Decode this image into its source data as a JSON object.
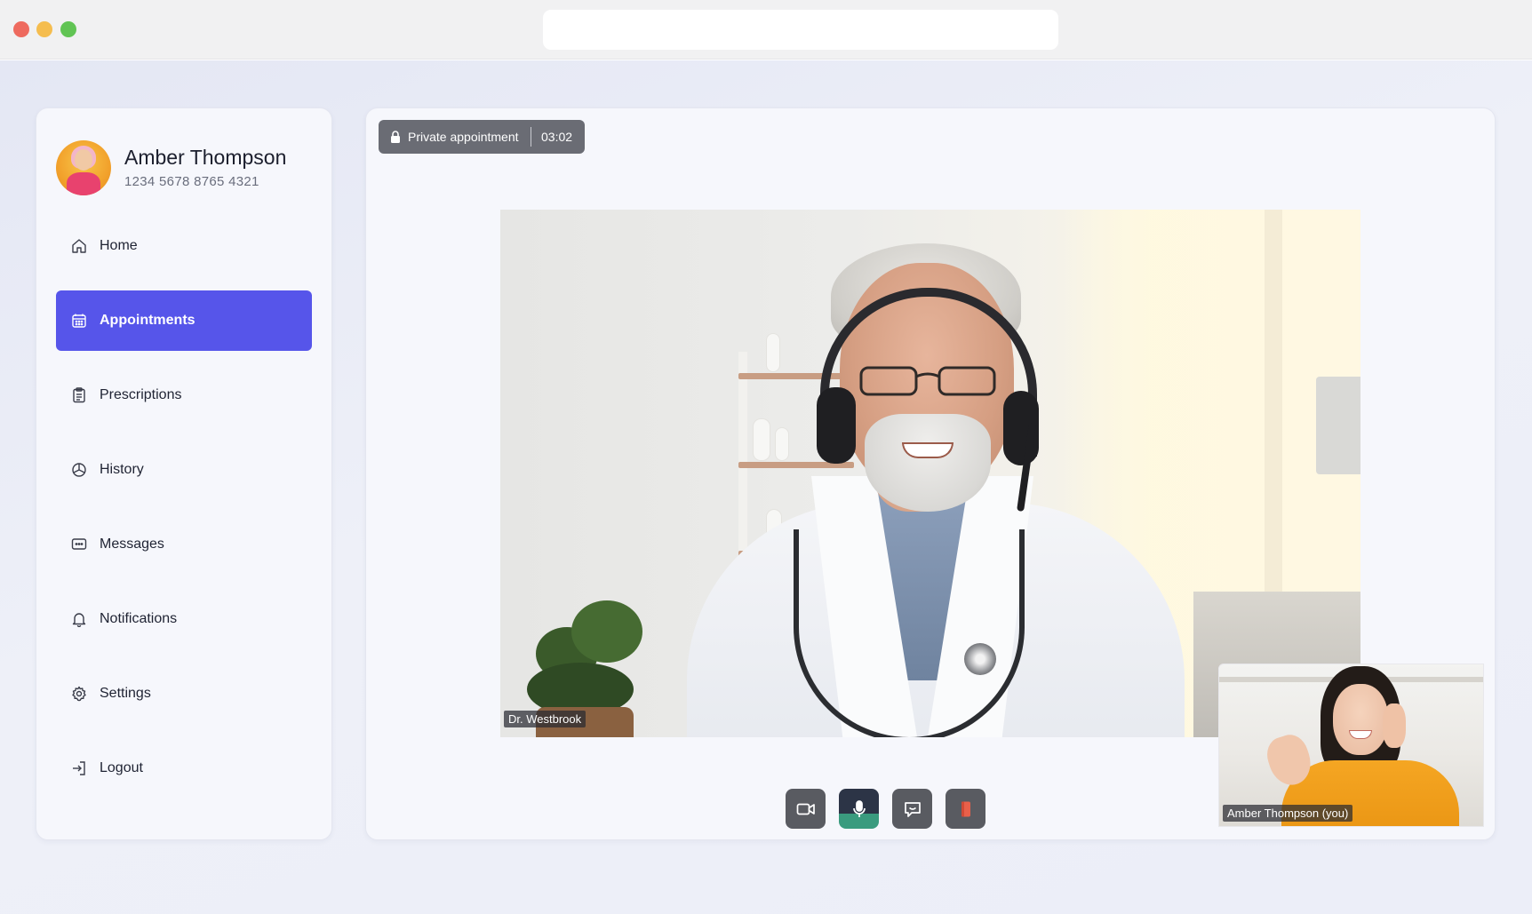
{
  "user": {
    "name": "Amber Thompson",
    "card_number": "1234 5678 8765 4321",
    "avatar_icon": "user-avatar"
  },
  "nav": {
    "items": [
      {
        "label": "Home",
        "icon": "home-icon",
        "active": false
      },
      {
        "label": "Appointments",
        "icon": "calendar-icon",
        "active": true
      },
      {
        "label": "Prescriptions",
        "icon": "clipboard-icon",
        "active": false
      },
      {
        "label": "History",
        "icon": "pie-chart-icon",
        "active": false
      },
      {
        "label": "Messages",
        "icon": "message-icon",
        "active": false
      },
      {
        "label": "Notifications",
        "icon": "bell-icon",
        "active": false
      },
      {
        "label": "Settings",
        "icon": "gear-icon",
        "active": false
      },
      {
        "label": "Logout",
        "icon": "logout-icon",
        "active": false
      }
    ]
  },
  "call": {
    "status_label": "Private appointment",
    "timer": "03:02",
    "remote_participant": "Dr. Westbrook",
    "local_participant": "Amber Thompson (you)",
    "controls": [
      {
        "name": "camera",
        "icon": "video-camera-icon"
      },
      {
        "name": "microphone",
        "icon": "microphone-icon",
        "level_pct": 38
      },
      {
        "name": "chat",
        "icon": "chat-icon"
      },
      {
        "name": "end-call",
        "icon": "phone-end-icon"
      }
    ]
  },
  "colors": {
    "accent": "#5655ea",
    "end_call": "#e8604a",
    "mic_level": "#3a9b7e",
    "control_bg": "#595b61"
  }
}
